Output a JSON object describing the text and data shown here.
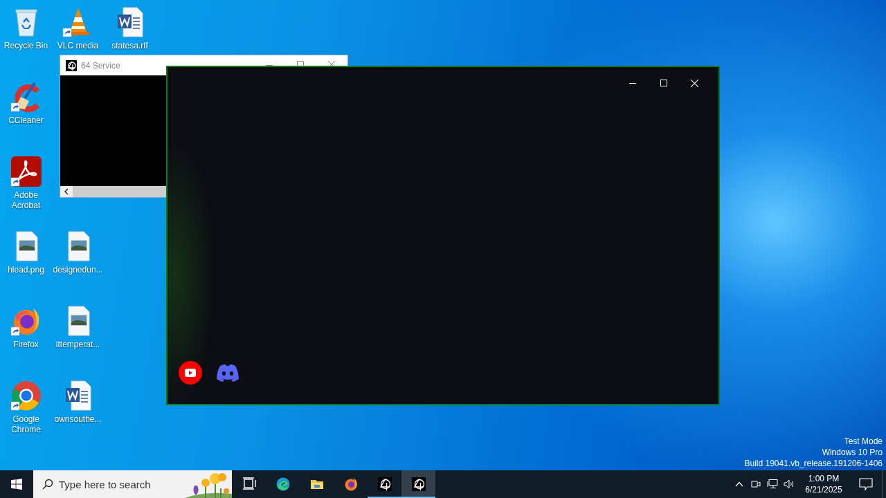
{
  "desktop": {
    "icons": [
      {
        "label": "Recycle Bin",
        "kind": "recycle-bin",
        "shortcut": false
      },
      {
        "label": "CCleaner",
        "kind": "ccleaner",
        "shortcut": true
      },
      {
        "label": "Adobe Acrobat",
        "kind": "acrobat",
        "shortcut": true
      },
      {
        "label": "hlead.png",
        "kind": "image-file",
        "shortcut": false
      },
      {
        "label": "Firefox",
        "kind": "firefox",
        "shortcut": true
      },
      {
        "label": "Google Chrome",
        "kind": "chrome",
        "shortcut": true
      },
      {
        "label": "VLC media",
        "kind": "vlc",
        "shortcut": true
      },
      {
        "label": "designedun...",
        "kind": "image-file",
        "shortcut": false
      },
      {
        "label": "ittemperat...",
        "kind": "image-file",
        "shortcut": false
      },
      {
        "label": "ownsouthe...",
        "kind": "word-file",
        "shortcut": false
      },
      {
        "label": "statesa.rtf",
        "kind": "word-file",
        "shortcut": false
      }
    ],
    "notice": [
      "Test Mode",
      "Windows 10 Pro",
      "Build 19041.vb_release.191206-1406"
    ]
  },
  "service_window": {
    "title": "64 Service"
  },
  "app_window": {
    "links": [
      {
        "kind": "youtube"
      },
      {
        "kind": "discord"
      }
    ]
  },
  "taskbar": {
    "search": {
      "placeholder": "Type here to search"
    },
    "apps": [
      {
        "kind": "task-view",
        "running": false,
        "selected": false
      },
      {
        "kind": "edge",
        "running": false,
        "selected": false
      },
      {
        "kind": "explorer",
        "running": false,
        "selected": false
      },
      {
        "kind": "firefox",
        "running": false,
        "selected": false
      },
      {
        "kind": "app",
        "running": true,
        "selected": false
      },
      {
        "kind": "app",
        "running": true,
        "selected": true
      }
    ],
    "clock": {
      "time": "1:00 PM",
      "date": "6/21/2025"
    }
  }
}
